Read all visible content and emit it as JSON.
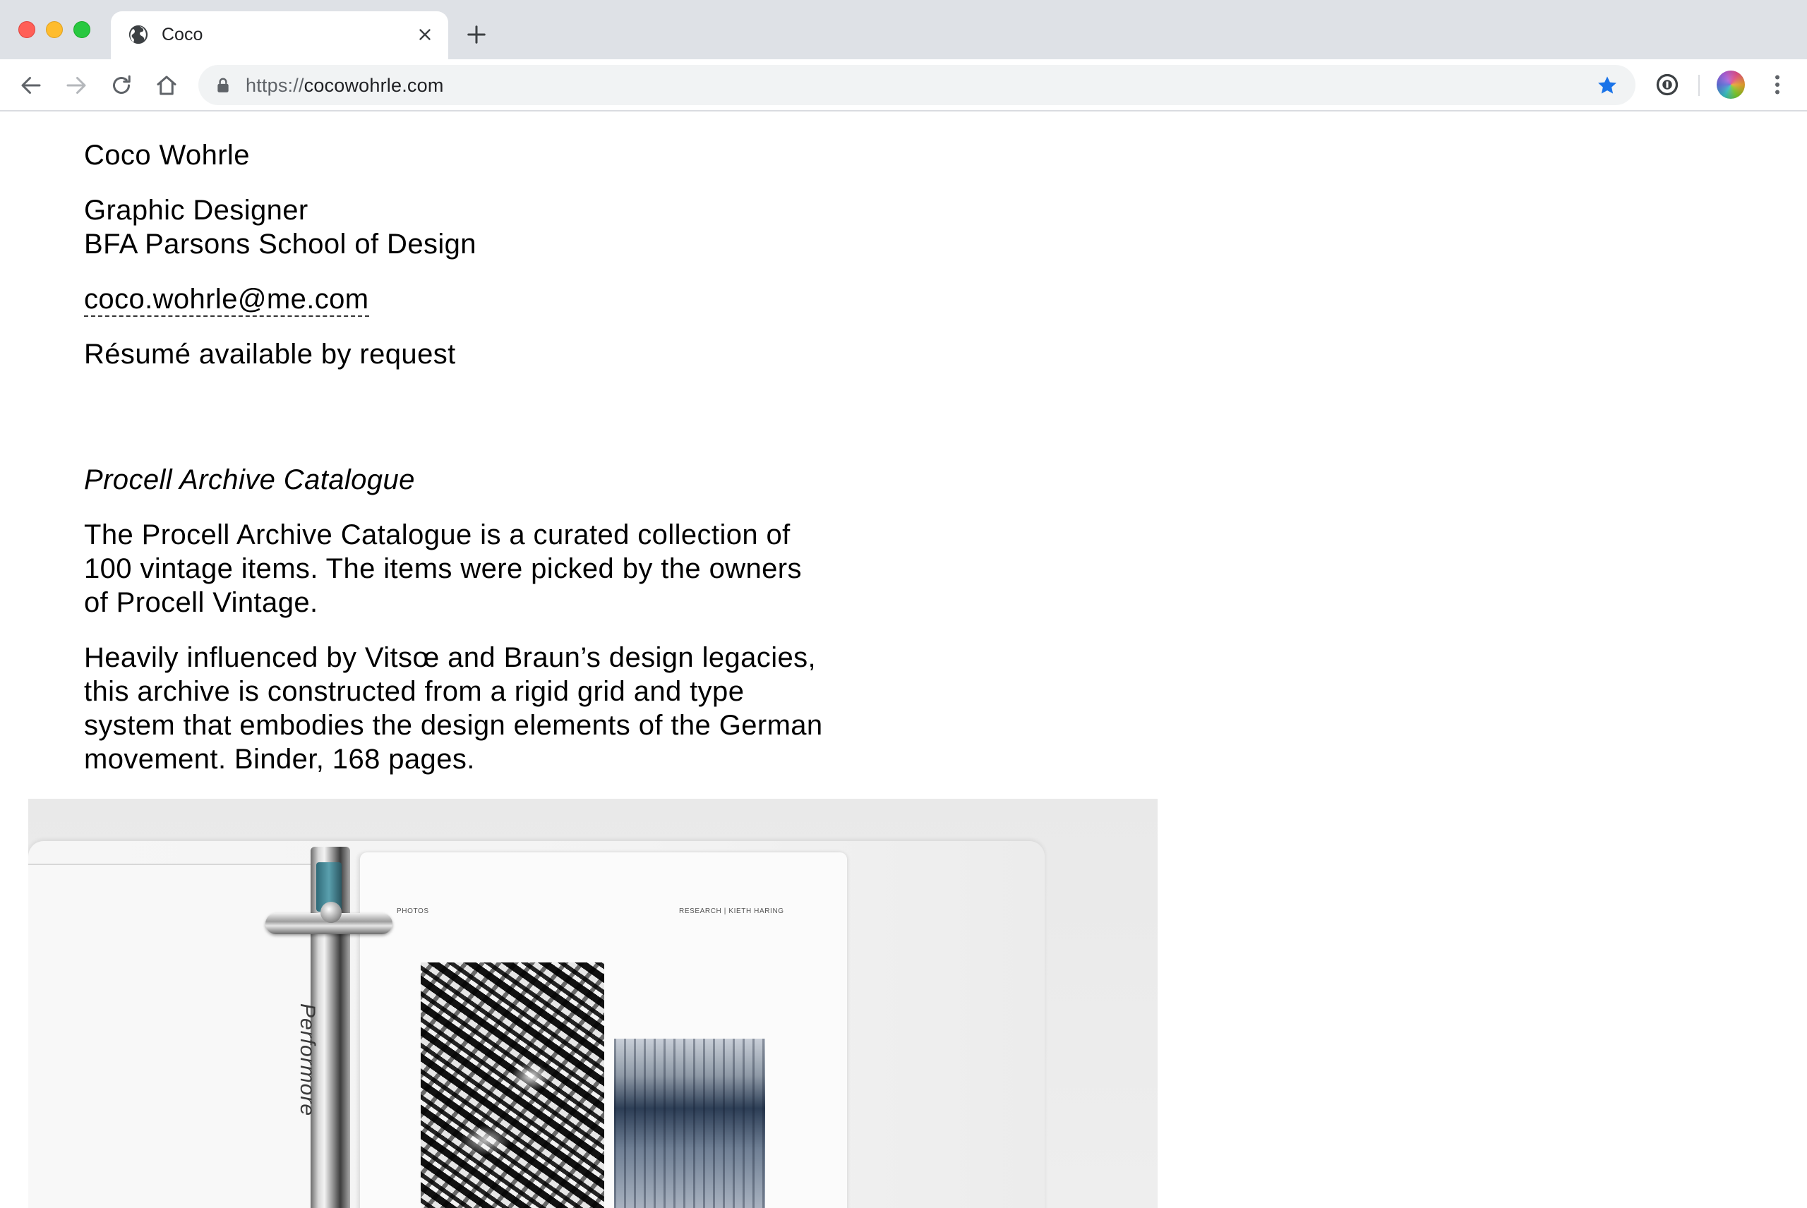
{
  "browser": {
    "tab": {
      "title": "Coco"
    },
    "address_bar": {
      "url_scheme": "https://",
      "url_host": "cocowohrle.com"
    }
  },
  "intro": {
    "name": "Coco Wohrle",
    "role": "Graphic Designer",
    "school": "BFA Parsons School of Design",
    "email": "coco.wohrle@me.com",
    "resume_note": "Résumé available by request"
  },
  "project": {
    "title": "Procell Archive Catalogue",
    "paragraphs": [
      "The Procell Archive Catalogue is a curated collection of 100 vintage items. The items were picked by the owners of Procell Vintage.",
      "Heavily influenced by Vitsœ and Braun’s design legacies, this archive is constructed from a rigid grid and type system that embodies the design elements of the German movement. Binder, 168 pages."
    ],
    "photo": {
      "page_label_left": "PHOTOS",
      "page_label_right": "RESEARCH  |  KIETH HARING",
      "spine_text": "Performore"
    }
  },
  "colors": {
    "tab_strip": "#dee1e6",
    "omnibox": "#f1f3f4",
    "bookmark_star": "#1a73e8",
    "text": "#000000"
  }
}
